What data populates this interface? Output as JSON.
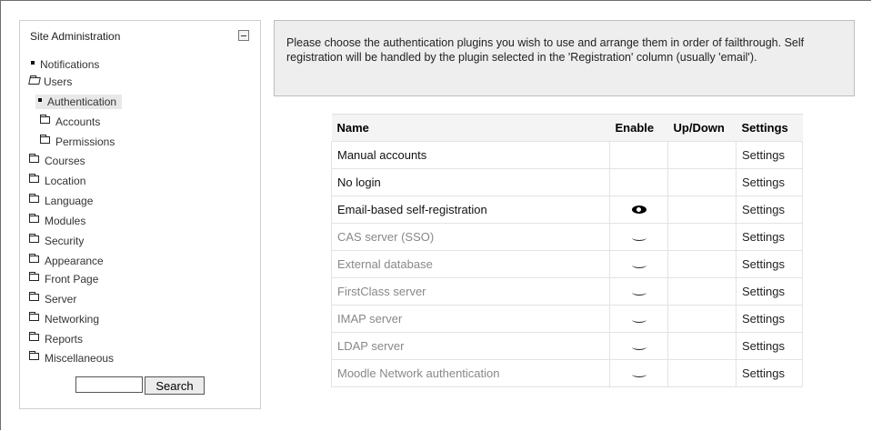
{
  "sidebar": {
    "title": "Site Administration",
    "items": [
      {
        "label": "Notifications",
        "icon": "bullet-icon"
      },
      {
        "label": "Users",
        "icon": "folder-open-icon"
      },
      {
        "label": "Authentication",
        "icon": "bullet-icon"
      },
      {
        "label": "Accounts",
        "icon": "folder-icon"
      },
      {
        "label": "Permissions",
        "icon": "folder-icon"
      },
      {
        "label": "Courses",
        "icon": "folder-icon"
      },
      {
        "label": "Location",
        "icon": "folder-icon"
      },
      {
        "label": "Language",
        "icon": "folder-icon"
      },
      {
        "label": "Modules",
        "icon": "folder-icon"
      },
      {
        "label": "Security",
        "icon": "folder-icon"
      },
      {
        "label": "Appearance",
        "icon": "folder-icon"
      },
      {
        "label": "Front Page",
        "icon": "folder-icon"
      },
      {
        "label": "Server",
        "icon": "folder-icon"
      },
      {
        "label": "Networking",
        "icon": "folder-icon"
      },
      {
        "label": "Reports",
        "icon": "folder-icon"
      },
      {
        "label": "Miscellaneous",
        "icon": "folder-icon"
      }
    ],
    "search_button": "Search",
    "search_value": ""
  },
  "info": {
    "text": "Please choose the authentication plugins you wish to use and arrange them in order of failthrough. Self registration will be handled by the plugin selected in the 'Registration' column (usually 'email')."
  },
  "table": {
    "headers": {
      "name": "Name",
      "enable": "Enable",
      "updown": "Up/Down",
      "settings": "Settings"
    },
    "rows": [
      {
        "name": "Manual accounts",
        "settings": "Settings",
        "enable_icon": "none",
        "active": true
      },
      {
        "name": "No login",
        "settings": "Settings",
        "enable_icon": "none",
        "active": true
      },
      {
        "name": "Email-based self-registration",
        "settings": "Settings",
        "enable_icon": "eye-open-icon",
        "active": true
      },
      {
        "name": "CAS server (SSO)",
        "settings": "Settings",
        "enable_icon": "eye-closed-icon",
        "active": false
      },
      {
        "name": "External database",
        "settings": "Settings",
        "enable_icon": "eye-closed-icon",
        "active": false
      },
      {
        "name": "FirstClass server",
        "settings": "Settings",
        "enable_icon": "eye-closed-icon",
        "active": false
      },
      {
        "name": "IMAP server",
        "settings": "Settings",
        "enable_icon": "eye-closed-icon",
        "active": false
      },
      {
        "name": "LDAP server",
        "settings": "Settings",
        "enable_icon": "eye-closed-icon",
        "active": false
      },
      {
        "name": "Moodle Network authentication",
        "settings": "Settings",
        "enable_icon": "eye-closed-icon",
        "active": false
      }
    ]
  }
}
